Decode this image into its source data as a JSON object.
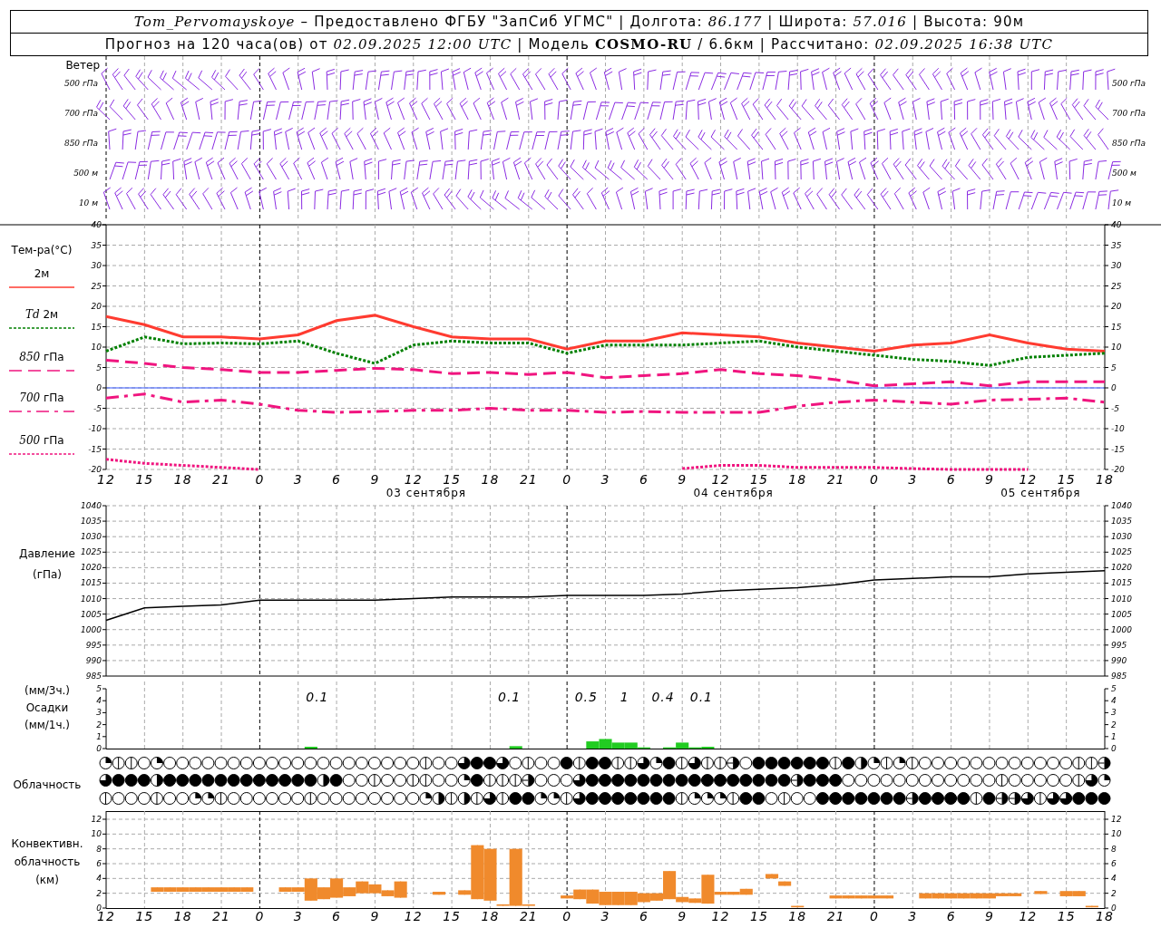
{
  "header": {
    "line1": "*Tom_Pervomayskoye* – Предоставлено ФГБУ \"ЗапСиб УГМС\" | Долгота: *86.177* | Широта: *57.016* | Высота: 90м",
    "line2": "Прогноз на 120 часа(ов) от *02.09.2025 12:00 UTC*  | Модель **COSMO-RU** / 6.6км | Рассчитано: *02.09.2025 16:38 UTC*"
  },
  "wind": {
    "title": "Ветер",
    "left_labels": [
      {
        "label": "500",
        "unit": "гПа"
      },
      {
        "label": "700",
        "unit": "гПа"
      },
      {
        "label": "850",
        "unit": "гПа"
      },
      {
        "label": "500",
        "unit": "м"
      },
      {
        "label": "10",
        "unit": "м"
      }
    ],
    "right_labels": [
      {
        "label": "500",
        "unit": "гПа"
      },
      {
        "label": "700",
        "unit": "гПа"
      },
      {
        "label": "850",
        "unit": "гПа"
      },
      {
        "label": "500",
        "unit": "м"
      },
      {
        "label": "10",
        "unit": "м"
      }
    ]
  },
  "temperature": {
    "title": "Тем-ра(°C)",
    "legend": [
      {
        "unit": "2м"
      },
      {
        "label": "Td",
        "unit": "2м"
      },
      {
        "label": "850",
        "unit": "гПа"
      },
      {
        "label": "700",
        "unit": "гПа"
      },
      {
        "label": "500",
        "unit": "гПа"
      }
    ],
    "day_labels": [
      "03 сентября",
      "04 сентября",
      "05 сентября"
    ],
    "right_ticks": [
      "40",
      "35",
      "30",
      "25",
      "20",
      "15",
      "10",
      "5",
      "0",
      "-5",
      "-10",
      "-15",
      "-20"
    ],
    "chart_data": {
      "type": "line",
      "grid": true,
      "ref_lines": [
        {
          "axis": "y",
          "value": 0,
          "color": "#3355ff"
        }
      ],
      "ylim": [
        -20,
        40
      ],
      "yticks": [
        -20,
        -15,
        -10,
        -5,
        0,
        5,
        10,
        15,
        20,
        25,
        30,
        35,
        40
      ],
      "categories": [
        "12",
        "15",
        "18",
        "21",
        "0",
        "3",
        "6",
        "9",
        "12",
        "15",
        "18",
        "21",
        "0",
        "3",
        "6",
        "9",
        "12",
        "15",
        "18",
        "21",
        "0",
        "3",
        "6",
        "9",
        "12",
        "15",
        "18"
      ],
      "series": [
        {
          "color": "#ff3b30",
          "line_style": "solid",
          "values": [
            17.5,
            15.5,
            12.5,
            12.5,
            12,
            13,
            16.5,
            17.8,
            15,
            12.5,
            12,
            12,
            9.5,
            11.5,
            11.5,
            13.5,
            13,
            12.5,
            11,
            10,
            9,
            10.5,
            11,
            13,
            11,
            9.5,
            9
          ]
        },
        {
          "color": "#008000",
          "line_style": "dotted",
          "values": [
            9,
            12.5,
            10.8,
            11,
            10.8,
            11.5,
            8.5,
            6,
            10.5,
            11.5,
            11,
            11,
            8.5,
            10.5,
            10.5,
            10.5,
            11,
            11.5,
            10,
            9,
            8,
            7,
            6.5,
            5.5,
            7.5,
            8,
            8.5
          ]
        },
        {
          "color": "#f0157f",
          "line_style": "dashed",
          "values": [
            6.8,
            6,
            5,
            4.5,
            3.8,
            3.8,
            4.3,
            4.8,
            4.5,
            3.5,
            3.8,
            3.3,
            3.8,
            2.5,
            3,
            3.5,
            4.5,
            3.5,
            3,
            2,
            0.5,
            1,
            1.5,
            0.5,
            1.5,
            1.5,
            1.5
          ]
        },
        {
          "color": "#f0157f",
          "line_style": "dashdot",
          "values": [
            -2.5,
            -1.5,
            -3.5,
            -3,
            -4,
            -5.5,
            -6,
            -5.8,
            -5.5,
            -5.5,
            -5,
            -5.5,
            -5.5,
            -6,
            -5.8,
            -6,
            -6,
            -6,
            -4.5,
            -3.5,
            -3,
            -3.5,
            -4,
            -3,
            -2.8,
            -2.5,
            -3.5
          ]
        },
        {
          "color": "#f0157f",
          "line_style": "dotted",
          "values": [
            -17.5,
            -18.5,
            -19,
            -19.5,
            -20,
            null,
            null,
            null,
            null,
            null,
            null,
            null,
            null,
            null,
            null,
            -19.8,
            -19,
            -19,
            -19.5,
            -19.5,
            -19.5,
            -19.8,
            -20,
            -20,
            -20,
            null,
            null
          ]
        }
      ]
    }
  },
  "pressure": {
    "title": "Давление",
    "unit": "(гПа)",
    "right_ticks": [
      "1040",
      "1035",
      "1030",
      "1025",
      "1020",
      "1015",
      "1010",
      "1005",
      "1000",
      "995",
      "990",
      "985"
    ],
    "chart_data": {
      "type": "line",
      "grid": true,
      "categories": [
        null,
        null,
        null,
        null,
        null,
        null,
        null,
        null,
        null,
        null,
        null,
        null,
        null,
        null,
        null,
        null,
        null,
        null,
        null,
        null,
        null,
        null,
        null,
        null,
        null,
        null,
        null
      ],
      "ylim": [
        985,
        1040
      ],
      "yticks": [
        985,
        990,
        995,
        1000,
        1005,
        1010,
        1015,
        1020,
        1025,
        1030,
        1035,
        1040
      ],
      "series": [
        {
          "color": "#000000",
          "values": [
            1003,
            1007,
            1007.5,
            1008,
            1009.5,
            1009.5,
            1009.5,
            1009.5,
            1010,
            1010.5,
            1010.5,
            1010.5,
            1011,
            1011,
            1011,
            1011.5,
            1012.5,
            1013,
            1013.5,
            1014.5,
            1016,
            1016.5,
            1017,
            1017,
            1018,
            1018.5,
            1019
          ]
        }
      ]
    }
  },
  "precipitation": {
    "labels": [
      "(мм/3ч.)",
      "Осадки",
      "(мм/1ч.)"
    ],
    "right_ticks": [
      "5",
      "4",
      "3",
      "2",
      "1",
      "0"
    ],
    "chart_data": {
      "type": "bar",
      "grid": true,
      "categories": [
        null,
        null,
        null,
        null,
        null,
        null,
        null,
        null,
        null,
        null,
        null,
        null,
        null,
        null,
        null,
        null,
        null,
        null,
        null,
        null,
        null,
        null,
        null,
        null,
        null,
        null,
        null,
        null,
        null,
        null,
        null,
        null,
        null,
        null,
        null,
        null,
        null,
        null,
        null,
        null,
        null,
        null,
        null,
        null,
        null,
        null,
        null,
        null,
        null,
        null,
        null,
        null,
        null,
        null,
        null,
        null,
        null,
        null,
        null,
        null,
        null,
        null,
        null,
        null,
        null,
        null,
        null,
        null,
        null,
        null,
        null,
        null,
        null,
        null,
        null,
        null,
        null,
        null,
        null
      ],
      "ylim": [
        0,
        5
      ],
      "yticks": [
        0,
        1,
        2,
        3,
        4,
        5
      ],
      "series": [
        {
          "color": "#22cc22",
          "values": [
            0,
            0,
            0,
            0,
            0,
            0,
            0,
            0,
            0,
            0,
            0,
            0,
            0,
            0,
            0,
            0,
            0.15,
            0,
            0,
            0,
            0,
            0,
            0,
            0,
            0,
            0,
            0,
            0,
            0,
            0,
            0,
            0,
            0.2,
            0,
            0,
            0,
            0,
            0,
            0.6,
            0.8,
            0.5,
            0.5,
            0.1,
            0,
            0.1,
            0.5,
            0.1,
            0.15,
            0,
            0,
            0,
            0,
            0,
            0,
            0,
            0,
            0,
            0,
            0,
            0,
            0,
            0,
            0,
            0,
            0,
            0,
            0,
            0,
            0,
            0,
            0,
            0,
            0,
            0,
            0,
            0,
            0,
            0,
            0
          ]
        }
      ],
      "annotations": [
        "0.1",
        "0.1",
        "0.5",
        "1",
        "0.4",
        "0.1"
      ]
    }
  },
  "clouds": {
    "title": "Облачность",
    "rows": [
      {
        "cells": [
          {
            "kind": "quarter"
          },
          {
            "kind": "trace"
          },
          {
            "kind": "trace"
          },
          {
            "kind": "clear"
          },
          {
            "kind": "quarter"
          },
          {
            "kind": "clear"
          },
          {
            "kind": "clear"
          },
          {
            "kind": "clear"
          },
          {
            "kind": "clear"
          },
          {
            "kind": "clear"
          },
          {
            "kind": "clear"
          },
          {
            "kind": "clear"
          },
          {
            "kind": "clear"
          },
          {
            "kind": "clear"
          },
          {
            "kind": "clear"
          },
          {
            "kind": "clear"
          },
          {
            "kind": "clear"
          },
          {
            "kind": "clear"
          },
          {
            "kind": "clear"
          },
          {
            "kind": "clear"
          },
          {
            "kind": "clear"
          },
          {
            "kind": "clear"
          },
          {
            "kind": "clear"
          },
          {
            "kind": "clear"
          },
          {
            "kind": "clear"
          },
          {
            "kind": "trace"
          },
          {
            "kind": "clear"
          },
          {
            "kind": "clear"
          },
          {
            "kind": "most"
          },
          {
            "kind": "overcast"
          },
          {
            "kind": "overcast"
          },
          {
            "kind": "most"
          },
          {
            "kind": "clear"
          },
          {
            "kind": "trace"
          },
          {
            "kind": "clear"
          },
          {
            "kind": "clear"
          },
          {
            "kind": "overcast"
          },
          {
            "kind": "trace"
          },
          {
            "kind": "overcast"
          },
          {
            "kind": "overcast"
          },
          {
            "kind": "trace"
          },
          {
            "kind": "trace"
          },
          {
            "kind": "most"
          },
          {
            "kind": "quarter"
          },
          {
            "kind": "overcast"
          },
          {
            "kind": "trace"
          },
          {
            "kind": "most"
          },
          {
            "kind": "trace"
          },
          {
            "kind": "trace"
          },
          {
            "kind": "halfbar"
          },
          {
            "kind": "clear"
          },
          {
            "kind": "overcast"
          },
          {
            "kind": "overcast"
          },
          {
            "kind": "overcast"
          },
          {
            "kind": "overcast"
          },
          {
            "kind": "overcast"
          },
          {
            "kind": "overcast"
          },
          {
            "kind": "trace"
          },
          {
            "kind": "overcast"
          },
          {
            "kind": "half"
          },
          {
            "kind": "quarter"
          },
          {
            "kind": "trace"
          },
          {
            "kind": "quarter"
          },
          {
            "kind": "trace"
          },
          {
            "kind": "clear"
          },
          {
            "kind": "clear"
          },
          {
            "kind": "clear"
          },
          {
            "kind": "clear"
          },
          {
            "kind": "clear"
          },
          {
            "kind": "clear"
          },
          {
            "kind": "clear"
          },
          {
            "kind": "clear"
          },
          {
            "kind": "clear"
          },
          {
            "kind": "clear"
          },
          {
            "kind": "clear"
          },
          {
            "kind": "clear"
          },
          {
            "kind": "trace"
          },
          {
            "kind": "trace"
          },
          {
            "kind": "halfbar"
          }
        ]
      },
      {
        "cells": [
          {
            "kind": "most"
          },
          {
            "kind": "overcast"
          },
          {
            "kind": "overcast"
          },
          {
            "kind": "overcast"
          },
          {
            "kind": "half"
          },
          {
            "kind": "overcast"
          },
          {
            "kind": "overcast"
          },
          {
            "kind": "overcast"
          },
          {
            "kind": "overcast"
          },
          {
            "kind": "overcast"
          },
          {
            "kind": "overcast"
          },
          {
            "kind": "overcast"
          },
          {
            "kind": "overcast"
          },
          {
            "kind": "overcast"
          },
          {
            "kind": "overcast"
          },
          {
            "kind": "overcast"
          },
          {
            "kind": "overcast"
          },
          {
            "kind": "half"
          },
          {
            "kind": "overcast"
          },
          {
            "kind": "clear"
          },
          {
            "kind": "clear"
          },
          {
            "kind": "trace"
          },
          {
            "kind": "clear"
          },
          {
            "kind": "clear"
          },
          {
            "kind": "trace"
          },
          {
            "kind": "trace"
          },
          {
            "kind": "clear"
          },
          {
            "kind": "clear"
          },
          {
            "kind": "quarter"
          },
          {
            "kind": "overcast"
          },
          {
            "kind": "trace"
          },
          {
            "kind": "trace"
          },
          {
            "kind": "trace"
          },
          {
            "kind": "halfbar"
          },
          {
            "kind": "clear"
          },
          {
            "kind": "clear"
          },
          {
            "kind": "clear"
          },
          {
            "kind": "most"
          },
          {
            "kind": "overcast"
          },
          {
            "kind": "overcast"
          },
          {
            "kind": "overcast"
          },
          {
            "kind": "overcast"
          },
          {
            "kind": "overcast"
          },
          {
            "kind": "overcast"
          },
          {
            "kind": "overcast"
          },
          {
            "kind": "overcast"
          },
          {
            "kind": "overcast"
          },
          {
            "kind": "overcast"
          },
          {
            "kind": "overcast"
          },
          {
            "kind": "overcast"
          },
          {
            "kind": "overcast"
          },
          {
            "kind": "overcast"
          },
          {
            "kind": "overcast"
          },
          {
            "kind": "overcast"
          },
          {
            "kind": "halfbar"
          },
          {
            "kind": "overcast"
          },
          {
            "kind": "overcast"
          },
          {
            "kind": "overcast"
          },
          {
            "kind": "clear"
          },
          {
            "kind": "clear"
          },
          {
            "kind": "clear"
          },
          {
            "kind": "clear"
          },
          {
            "kind": "clear"
          },
          {
            "kind": "clear"
          },
          {
            "kind": "clear"
          },
          {
            "kind": "clear"
          },
          {
            "kind": "clear"
          },
          {
            "kind": "clear"
          },
          {
            "kind": "clear"
          },
          {
            "kind": "clear"
          },
          {
            "kind": "trace"
          },
          {
            "kind": "clear"
          },
          {
            "kind": "clear"
          },
          {
            "kind": "clear"
          },
          {
            "kind": "clear"
          },
          {
            "kind": "clear"
          },
          {
            "kind": "trace"
          },
          {
            "kind": "most"
          },
          {
            "kind": "quarter"
          }
        ]
      },
      {
        "cells": [
          {
            "kind": "trace"
          },
          {
            "kind": "clear"
          },
          {
            "kind": "clear"
          },
          {
            "kind": "clear"
          },
          {
            "kind": "trace"
          },
          {
            "kind": "clear"
          },
          {
            "kind": "clear"
          },
          {
            "kind": "quarter"
          },
          {
            "kind": "quarter"
          },
          {
            "kind": "trace"
          },
          {
            "kind": "clear"
          },
          {
            "kind": "clear"
          },
          {
            "kind": "clear"
          },
          {
            "kind": "clear"
          },
          {
            "kind": "clear"
          },
          {
            "kind": "clear"
          },
          {
            "kind": "trace"
          },
          {
            "kind": "clear"
          },
          {
            "kind": "clear"
          },
          {
            "kind": "clear"
          },
          {
            "kind": "clear"
          },
          {
            "kind": "clear"
          },
          {
            "kind": "clear"
          },
          {
            "kind": "clear"
          },
          {
            "kind": "clear"
          },
          {
            "kind": "quarter"
          },
          {
            "kind": "half"
          },
          {
            "kind": "trace"
          },
          {
            "kind": "half"
          },
          {
            "kind": "trace"
          },
          {
            "kind": "most"
          },
          {
            "kind": "trace"
          },
          {
            "kind": "overcast"
          },
          {
            "kind": "overcast"
          },
          {
            "kind": "quarter"
          },
          {
            "kind": "quarter"
          },
          {
            "kind": "trace"
          },
          {
            "kind": "most"
          },
          {
            "kind": "overcast"
          },
          {
            "kind": "overcast"
          },
          {
            "kind": "overcast"
          },
          {
            "kind": "overcast"
          },
          {
            "kind": "overcast"
          },
          {
            "kind": "overcast"
          },
          {
            "kind": "overcast"
          },
          {
            "kind": "trace"
          },
          {
            "kind": "quarter"
          },
          {
            "kind": "quarter"
          },
          {
            "kind": "quarter"
          },
          {
            "kind": "trace"
          },
          {
            "kind": "overcast"
          },
          {
            "kind": "overcast"
          },
          {
            "kind": "clear"
          },
          {
            "kind": "trace"
          },
          {
            "kind": "clear"
          },
          {
            "kind": "clear"
          },
          {
            "kind": "overcast"
          },
          {
            "kind": "overcast"
          },
          {
            "kind": "overcast"
          },
          {
            "kind": "overcast"
          },
          {
            "kind": "overcast"
          },
          {
            "kind": "overcast"
          },
          {
            "kind": "overcast"
          },
          {
            "kind": "halfbar"
          },
          {
            "kind": "overcast"
          },
          {
            "kind": "overcast"
          },
          {
            "kind": "overcast"
          },
          {
            "kind": "overcast"
          },
          {
            "kind": "trace"
          },
          {
            "kind": "overcast"
          },
          {
            "kind": "halfbar"
          },
          {
            "kind": "halfbar"
          },
          {
            "kind": "most"
          },
          {
            "kind": "trace"
          },
          {
            "kind": "most"
          },
          {
            "kind": "most"
          },
          {
            "kind": "overcast"
          },
          {
            "kind": "overcast"
          },
          {
            "kind": "overcast"
          }
        ]
      }
    ]
  },
  "convective": {
    "labels": [
      "Конвективн.",
      "облачность",
      "(км)"
    ],
    "right_ticks": [
      "12",
      "10",
      "8",
      "6",
      "4",
      "2",
      "0"
    ],
    "chart_data": {
      "type": "candlestick",
      "grid": true,
      "ylim": [
        0,
        12
      ],
      "yticks": [
        0,
        2,
        4,
        6,
        8,
        10,
        12
      ],
      "categories": [
        "12",
        null,
        null,
        "15",
        null,
        null,
        "18",
        null,
        null,
        "21",
        null,
        null,
        "0",
        null,
        null,
        "3",
        null,
        null,
        "6",
        null,
        null,
        "9",
        null,
        null,
        "12",
        null,
        null,
        "15",
        null,
        null,
        "18",
        null,
        null,
        "21",
        null,
        null,
        "0",
        null,
        null,
        "3",
        null,
        null,
        "6",
        null,
        null,
        "9",
        null,
        null,
        "12",
        null,
        null,
        "15",
        null,
        null,
        "18",
        null,
        null,
        "21",
        null,
        null,
        "0",
        null,
        null,
        "3",
        null,
        null,
        "6",
        null,
        null,
        "9",
        null,
        null,
        "12",
        null,
        null,
        "15",
        null,
        null,
        "18"
      ],
      "series": [
        {
          "color": "#f08a2c",
          "ohlc": [
            null,
            null,
            null,
            null,
            [
              2.2,
              2.8,
              2.2,
              2.8
            ],
            [
              2.2,
              2.8,
              2.2,
              2.8
            ],
            [
              2.2,
              2.8,
              2.2,
              2.8
            ],
            [
              2.2,
              2.8,
              2.2,
              2.8
            ],
            [
              2.2,
              2.8,
              2.2,
              2.8
            ],
            [
              2.2,
              2.8,
              2.2,
              2.8
            ],
            [
              2.2,
              2.8,
              2.2,
              2.8
            ],
            [
              2.2,
              2.8,
              2.2,
              2.8
            ],
            null,
            null,
            [
              2.2,
              2.8,
              2.2,
              2.8
            ],
            [
              2.2,
              2.8,
              2.2,
              2.8
            ],
            [
              1,
              4,
              1,
              4
            ],
            [
              1.2,
              2.8,
              1.2,
              2.8
            ],
            [
              1.4,
              4,
              1.4,
              4
            ],
            [
              1.6,
              2.8,
              1.6,
              2.8
            ],
            [
              2,
              3.6,
              2,
              3.6
            ],
            [
              2,
              3.2,
              2,
              3.2
            ],
            [
              1.6,
              2.4,
              1.6,
              2.4
            ],
            [
              1.4,
              3.6,
              1.4,
              3.6
            ],
            null,
            null,
            [
              1.8,
              2.2,
              1.8,
              2.2
            ],
            null,
            [
              1.8,
              2.4,
              1.8,
              2.4
            ],
            [
              1.2,
              8.5,
              1.2,
              8.5
            ],
            [
              1,
              8,
              1,
              8
            ],
            [
              0.3,
              0.5,
              0.3,
              0.5
            ],
            [
              0.3,
              8,
              0.3,
              8
            ],
            [
              0.3,
              0.5,
              0.3,
              0.5
            ],
            null,
            null,
            [
              1.3,
              1.7,
              1.3,
              1.7
            ],
            [
              1.2,
              2.5,
              1.2,
              2.5
            ],
            [
              0.6,
              2.5,
              0.6,
              2.5
            ],
            [
              0.4,
              2.2,
              0.4,
              2.2
            ],
            [
              0.4,
              2.2,
              0.4,
              2.2
            ],
            [
              0.4,
              2.2,
              0.4,
              2.2
            ],
            [
              0.8,
              2,
              0.8,
              2
            ],
            [
              1,
              2,
              1,
              2
            ],
            [
              1.2,
              5,
              1.2,
              5
            ],
            [
              0.8,
              1.5,
              0.8,
              1.5
            ],
            [
              0.7,
              1.3,
              0.7,
              1.3
            ],
            [
              0.6,
              4.5,
              0.6,
              4.5
            ],
            [
              1.8,
              2.2,
              1.8,
              2.2
            ],
            [
              1.8,
              2.2,
              1.8,
              2.2
            ],
            [
              1.8,
              2.6,
              1.8,
              2.6
            ],
            null,
            [
              4,
              4.6,
              4,
              4.6
            ],
            [
              3,
              3.6,
              3,
              3.6
            ],
            [
              0.1,
              0.3,
              0.1,
              0.3
            ],
            null,
            null,
            [
              1.3,
              1.7,
              1.3,
              1.7
            ],
            [
              1.3,
              1.7,
              1.3,
              1.7
            ],
            [
              1.3,
              1.7,
              1.3,
              1.7
            ],
            [
              1.3,
              1.7,
              1.3,
              1.7
            ],
            [
              1.3,
              1.7,
              1.3,
              1.7
            ],
            null,
            null,
            [
              1.3,
              2,
              1.3,
              2
            ],
            [
              1.3,
              2,
              1.3,
              2
            ],
            [
              1.3,
              2,
              1.3,
              2
            ],
            [
              1.3,
              2,
              1.3,
              2
            ],
            [
              1.3,
              2,
              1.3,
              2
            ],
            [
              1.3,
              2,
              1.3,
              2
            ],
            [
              1.6,
              2,
              1.6,
              2
            ],
            [
              1.6,
              2,
              1.6,
              2
            ],
            null,
            [
              1.9,
              2.3,
              1.9,
              2.3
            ],
            null,
            [
              1.6,
              2.3,
              1.6,
              2.3
            ],
            [
              1.6,
              2.3,
              1.6,
              2.3
            ],
            [
              0.1,
              0.3,
              0.1,
              0.3
            ],
            null
          ]
        }
      ]
    }
  }
}
